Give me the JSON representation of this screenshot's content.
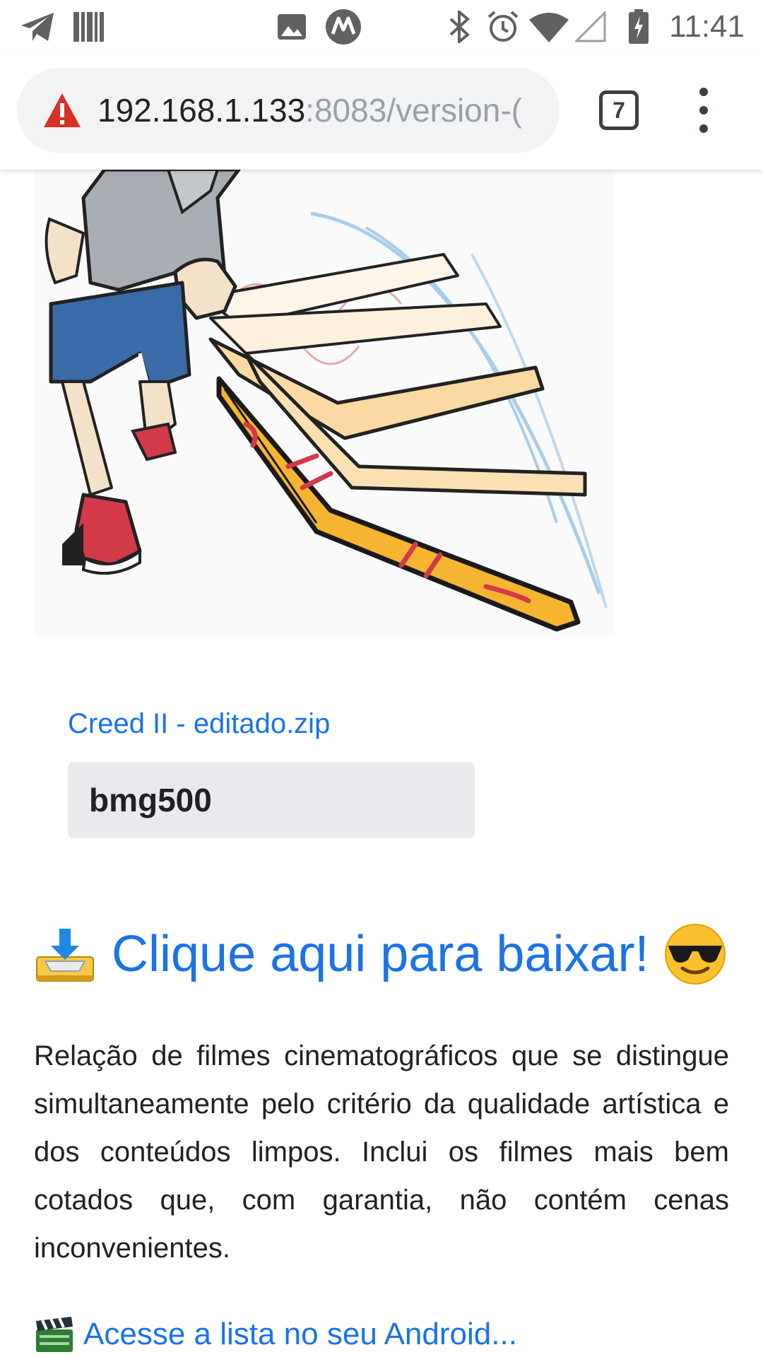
{
  "status_bar": {
    "time": "11:41",
    "icons": [
      "telegram-icon",
      "barcode-icon",
      "image-icon",
      "motorola-icon",
      "bluetooth-icon",
      "alarm-icon",
      "wifi-icon",
      "signal-icon",
      "battery-charging-icon"
    ]
  },
  "browser": {
    "url_host": "192.168.1.133",
    "url_path": ":8083/version-(",
    "tab_count": "7",
    "security_icon": "warning-icon",
    "menu_icon": "more-vert-icon"
  },
  "page": {
    "illustration": "boomerang-thrower-image",
    "file_link": "Creed II - editado.zip",
    "password": "bmg500",
    "download_link": "Clique aqui para baixar!",
    "download_icons": [
      "inbox-tray-emoji",
      "sunglasses-emoji"
    ],
    "description": "Relação de filmes cinematográficos que se distingue simultaneamente pelo critério da qualidade artística e dos conteúdos limpos. Inclui os filmes mais bem cotados que, com garantia, não contém cenas inconvenientes.",
    "android_link": "Acesse a lista no seu Android...",
    "android_icon": "clapper-board-emoji"
  },
  "colors": {
    "link": "#1a73e8",
    "warning": "#d93025",
    "boomerang": "#f6b530",
    "shorts": "#3b6aa8"
  }
}
